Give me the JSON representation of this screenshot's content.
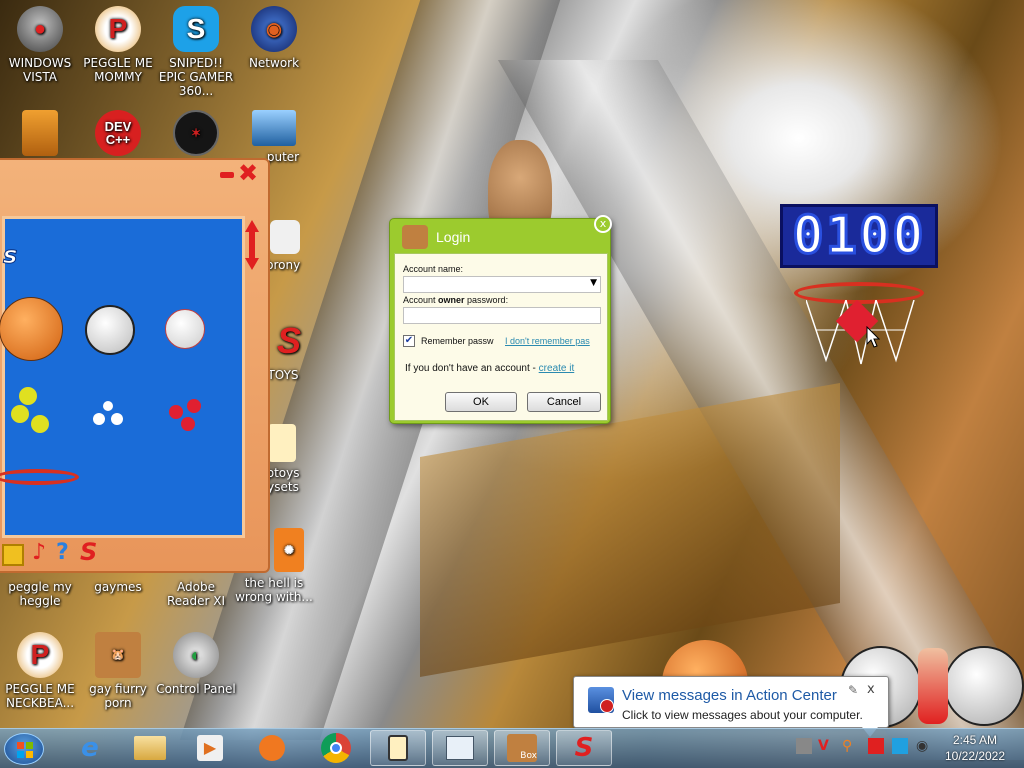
{
  "desktop": {
    "icons": [
      {
        "label": "WINDOWS VISTA",
        "icon": "vista-orb-icon"
      },
      {
        "label": "PEGGLE ME MOMMY",
        "icon": "peggle-icon"
      },
      {
        "label": "SNIPED!! EPIC GAMER 360...",
        "icon": "skype-icon"
      },
      {
        "label": "Network",
        "icon": "network-icon"
      },
      {
        "label": "",
        "icon": "game-block-icon"
      },
      {
        "label": "DEV C++",
        "icon": "devcpp-icon"
      },
      {
        "label": "",
        "icon": "dark-app-icon"
      },
      {
        "label": "puter",
        "icon": "computer-icon"
      },
      {
        "label": "brony",
        "icon": "shield-icon"
      },
      {
        "label": "TOYS",
        "icon": "s-logo-icon"
      },
      {
        "label": "ptoys ysets",
        "icon": "lantern-icon"
      },
      {
        "label": "peggle my heggle",
        "icon": ""
      },
      {
        "label": "gaymes",
        "icon": ""
      },
      {
        "label": "Adobe Reader XI",
        "icon": ""
      },
      {
        "label": "the hell is wrong with...",
        "icon": "flash-icon"
      },
      {
        "label": "PEGGLE ME NECKBEA...",
        "icon": "peggle-icon"
      },
      {
        "label": "gay fiurry porn",
        "icon": "hamster-box-icon"
      },
      {
        "label": "Control Panel",
        "icon": "control-panel-icon"
      }
    ],
    "devcpp_text": "DEV C++"
  },
  "game_window": {
    "min_symbol": "–",
    "close_symbol": "✖",
    "partial_logo": "s"
  },
  "scoreboard": {
    "value": "0100"
  },
  "login": {
    "title": "Login",
    "close_symbol": "x",
    "account_name_label": "Account name:",
    "password_label_pre": "Account ",
    "password_label_bold": "owner",
    "password_label_post": " password:",
    "account_name_value": "",
    "password_value": "",
    "remember_label": "Remember passw",
    "remember_checked": true,
    "forgot_link": "I don't remember pas",
    "no_account_text": "If you don't have an account - ",
    "create_link": "create it",
    "ok_label": "OK",
    "cancel_label": "Cancel"
  },
  "action_center": {
    "title": "View messages in Action Center",
    "subtitle": "Click to view messages about your computer.",
    "close_symbol": "x"
  },
  "taskbar": {
    "apps": [
      "internet-explorer-icon",
      "file-explorer-icon",
      "media-player-icon",
      "uc-browser-icon",
      "chrome-icon",
      "lantern-app-icon",
      "document-app-icon",
      "hamster-box-app-icon",
      "s-game-app-icon"
    ],
    "clock_time": "2:45 AM",
    "clock_date": "10/22/2022",
    "hamster_box_text": "Box",
    "tray_v": "V"
  }
}
